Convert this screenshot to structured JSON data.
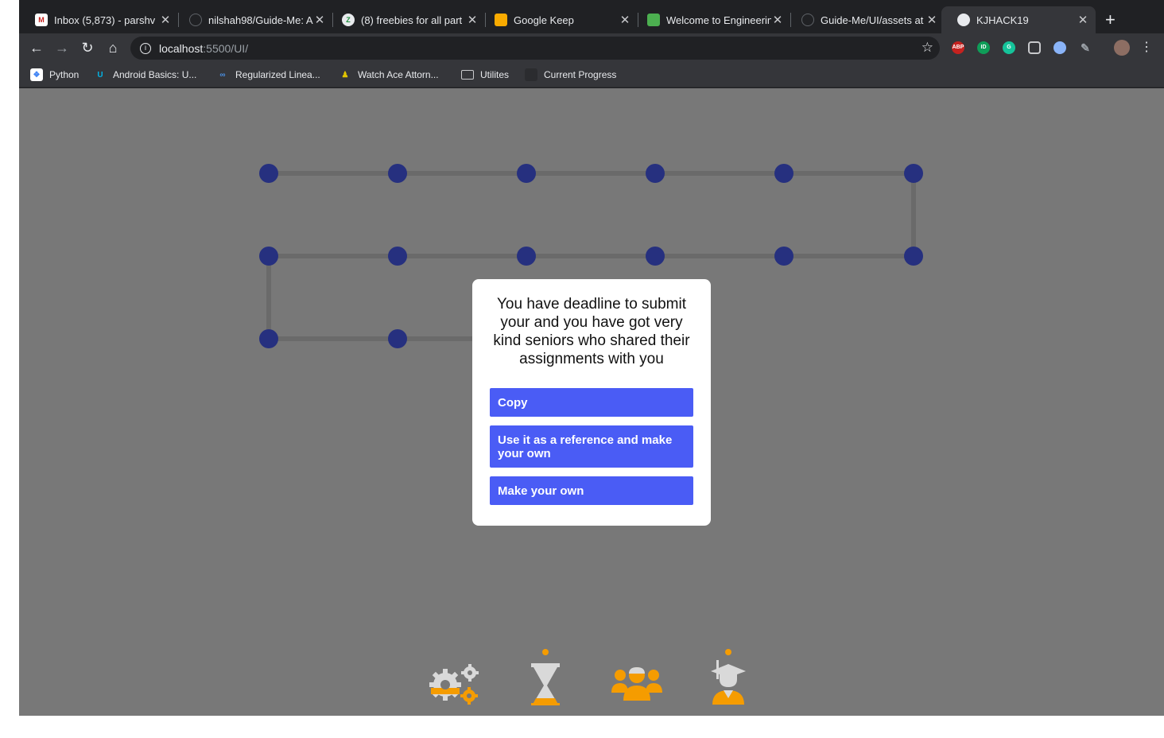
{
  "browser": {
    "tabs": [
      {
        "title": "Inbox (5,873) - parshv",
        "icon": "gmail-icon",
        "color": "#c5221f",
        "glyph": "M"
      },
      {
        "title": "nilshah98/Guide-Me: A",
        "icon": "github-icon",
        "color": "#202124",
        "glyph": ""
      },
      {
        "title": "(8) freebies for all part",
        "icon": "zoom-icon",
        "color": "#3c8",
        "glyph": "Z"
      },
      {
        "title": "Google Keep",
        "icon": "keep-icon",
        "color": "#f9ab00",
        "glyph": ""
      },
      {
        "title": "Welcome to Engineerin",
        "icon": "site-icon",
        "color": "#4caf50",
        "glyph": ""
      },
      {
        "title": "Guide-Me/UI/assets at",
        "icon": "github-icon",
        "color": "#202124",
        "glyph": ""
      },
      {
        "title": "KJHACK19",
        "icon": "globe-icon",
        "color": "#e8eaed",
        "glyph": ""
      }
    ],
    "new_tab": "+",
    "url_host": "localhost",
    "url_path": ":5500/UI/",
    "extensions": [
      {
        "name": "adblock-icon",
        "label": "ABP",
        "color": "#c5221f"
      },
      {
        "name": "green-extension-icon",
        "label": "ID",
        "color": "#0f9d58"
      },
      {
        "name": "grammarly-icon",
        "label": "G",
        "color": "#15c39a"
      },
      {
        "name": "pocket-icon",
        "label": "",
        "color": "#5f6368"
      },
      {
        "name": "blue-extension-icon",
        "label": "",
        "color": "#8ab4f8"
      }
    ],
    "bookmarks": [
      {
        "label": "Python",
        "icon": "python-icon"
      },
      {
        "label": "Android Basics: U...",
        "icon": "udacity-icon"
      },
      {
        "label": "Regularized Linea...",
        "icon": "coursera-icon"
      },
      {
        "label": "Watch Ace Attorn...",
        "icon": "ace-icon"
      },
      {
        "label": "Utilites",
        "icon": "folder-icon"
      },
      {
        "label": "Current Progress",
        "icon": "page-icon"
      }
    ]
  },
  "colors": {
    "page_bg": "#787878",
    "dot": "#26307f",
    "track": "#6a6a6a",
    "button": "#4a5cf5",
    "icon_orange": "#f59c00",
    "icon_gray": "#d9d9d9"
  },
  "modal": {
    "message": "You have deadline to submit your and you have got very kind seniors who shared their assignments with you",
    "options": [
      "Copy",
      "Use it as a reference and make your own",
      "Make your own"
    ]
  },
  "stats_icons": [
    "gears-icon",
    "hourglass-icon",
    "team-icon",
    "graduate-icon"
  ]
}
